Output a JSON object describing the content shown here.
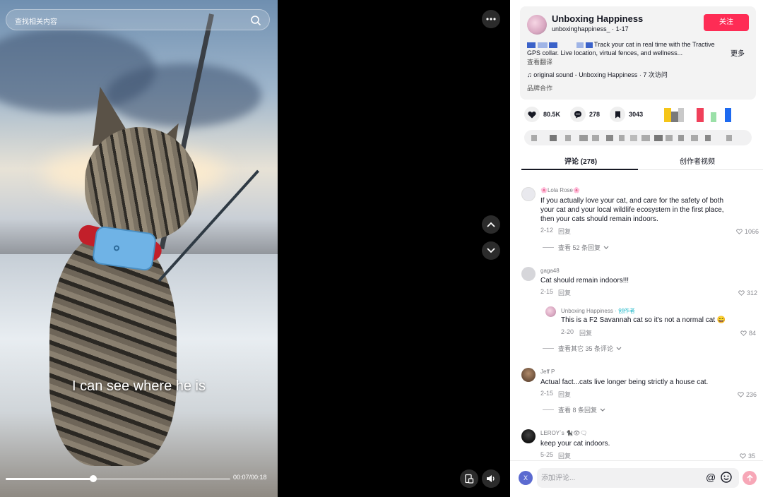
{
  "video": {
    "search_placeholder": "查找相关内容",
    "caption": "I can see where he is",
    "timecode": "00:07/00:18",
    "progress": 0.39
  },
  "info": {
    "author_name": "Unboxing Happiness",
    "handle": "unboxinghappiness_",
    "date": " · 1-17",
    "follow_label": "关注",
    "description": "Track your cat in real time with the Tractive GPS collar. Live location, virtual fences, and wellness...",
    "more_label": "更多",
    "translate_label": "查看翻译",
    "sound_label": "original sound - Unboxing Happiness · 7 次访问",
    "brand_label": "品牌合作"
  },
  "stats": {
    "likes": "80.5K",
    "comments": "278",
    "saves": "3043"
  },
  "tabs": {
    "comments": "评论 (278)",
    "creator_videos": "创作者视频"
  },
  "comments": [
    {
      "name": "🌸Lola Rose🌸",
      "text": "If you actually love your cat, and care for the safety of both your cat and your local wildlife ecosystem in the first place, then your cats should remain indoors.",
      "date": "2-12",
      "reply": "回复",
      "likes": "1066",
      "view_replies": "查看 52 条回复"
    },
    {
      "name": "gaga48",
      "text": "Cat should remain indoors!!!",
      "date": "2-15",
      "reply": "回复",
      "likes": "312",
      "sub": {
        "name": "Unboxing Happiness",
        "creator_tag": " · 创作者",
        "text": "This is a F2 Savannah cat so it's not a normal cat 😄",
        "date": "2-20",
        "reply": "回复",
        "likes": "84"
      },
      "view_replies": "查看其它 35 条评论"
    },
    {
      "name": "Jeff P",
      "text": "Actual fact...cats live longer being strictly a house cat.",
      "date": "2-15",
      "reply": "回复",
      "likes": "236",
      "view_replies": "查看 8 条回复"
    },
    {
      "name": "LEROY`s 🐈‍⬛👁🗨",
      "text": "keep your cat indoors.",
      "date": "5-25",
      "reply": "回复",
      "likes": "35"
    }
  ],
  "composer": {
    "avatar_letter": "X",
    "placeholder": "添加评论..."
  },
  "colors": {
    "accent": "#fe2c55",
    "creator": "#20b8c9"
  }
}
